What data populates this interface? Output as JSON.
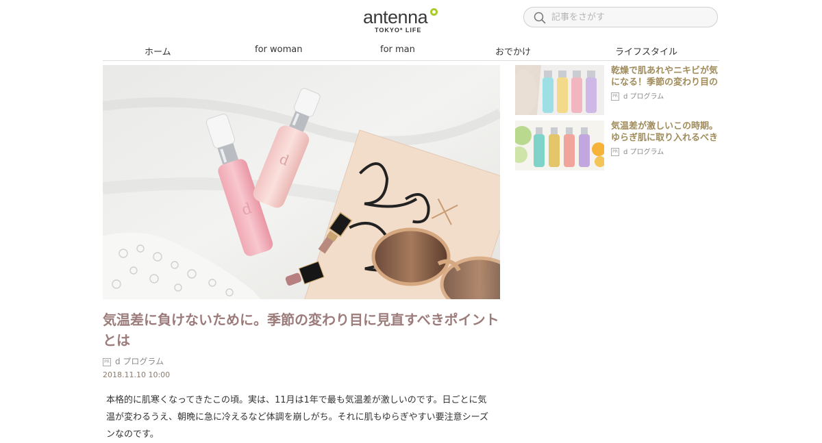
{
  "logo": {
    "main": "antenna",
    "sub": "TOKYO* LIFE"
  },
  "search": {
    "placeholder": "記事をさがす"
  },
  "nav": [
    {
      "label": "ホーム"
    },
    {
      "label": "for woman"
    },
    {
      "label": "for man"
    },
    {
      "label": "おでかけ"
    },
    {
      "label": "ライフスタイル"
    }
  ],
  "hero": {
    "book_text": "Love x Style"
  },
  "article": {
    "title": "気温差に負けないために。季節の変わり目に見直すべきポイントとは",
    "pr_badge": "PR",
    "sponsor": "d プログラム",
    "date": "2018.11.10 10:00",
    "body": "本格的に肌寒くなってきたこの頃。実は、11月は1年で最も気温差が激しいのです。日ごとに気温が変わるうえ、朝晩に急に冷えるなど体調を崩しがち。それに肌もゆらぎやすい要注意シーズンなのです。"
  },
  "sidebar": [
    {
      "title": "乾燥で肌あれやニキビが気になる！季節の変わり目の",
      "pr_badge": "PR",
      "sponsor": "d プログラム"
    },
    {
      "title": "気温差が激しいこの時期。ゆらぎ肌に取り入れるべき",
      "pr_badge": "PR",
      "sponsor": "d プログラム"
    }
  ],
  "colors": {
    "title": "#9c7b7b",
    "sidebar_title": "#a08b5a",
    "logo_badge": "#a9cc2a"
  }
}
